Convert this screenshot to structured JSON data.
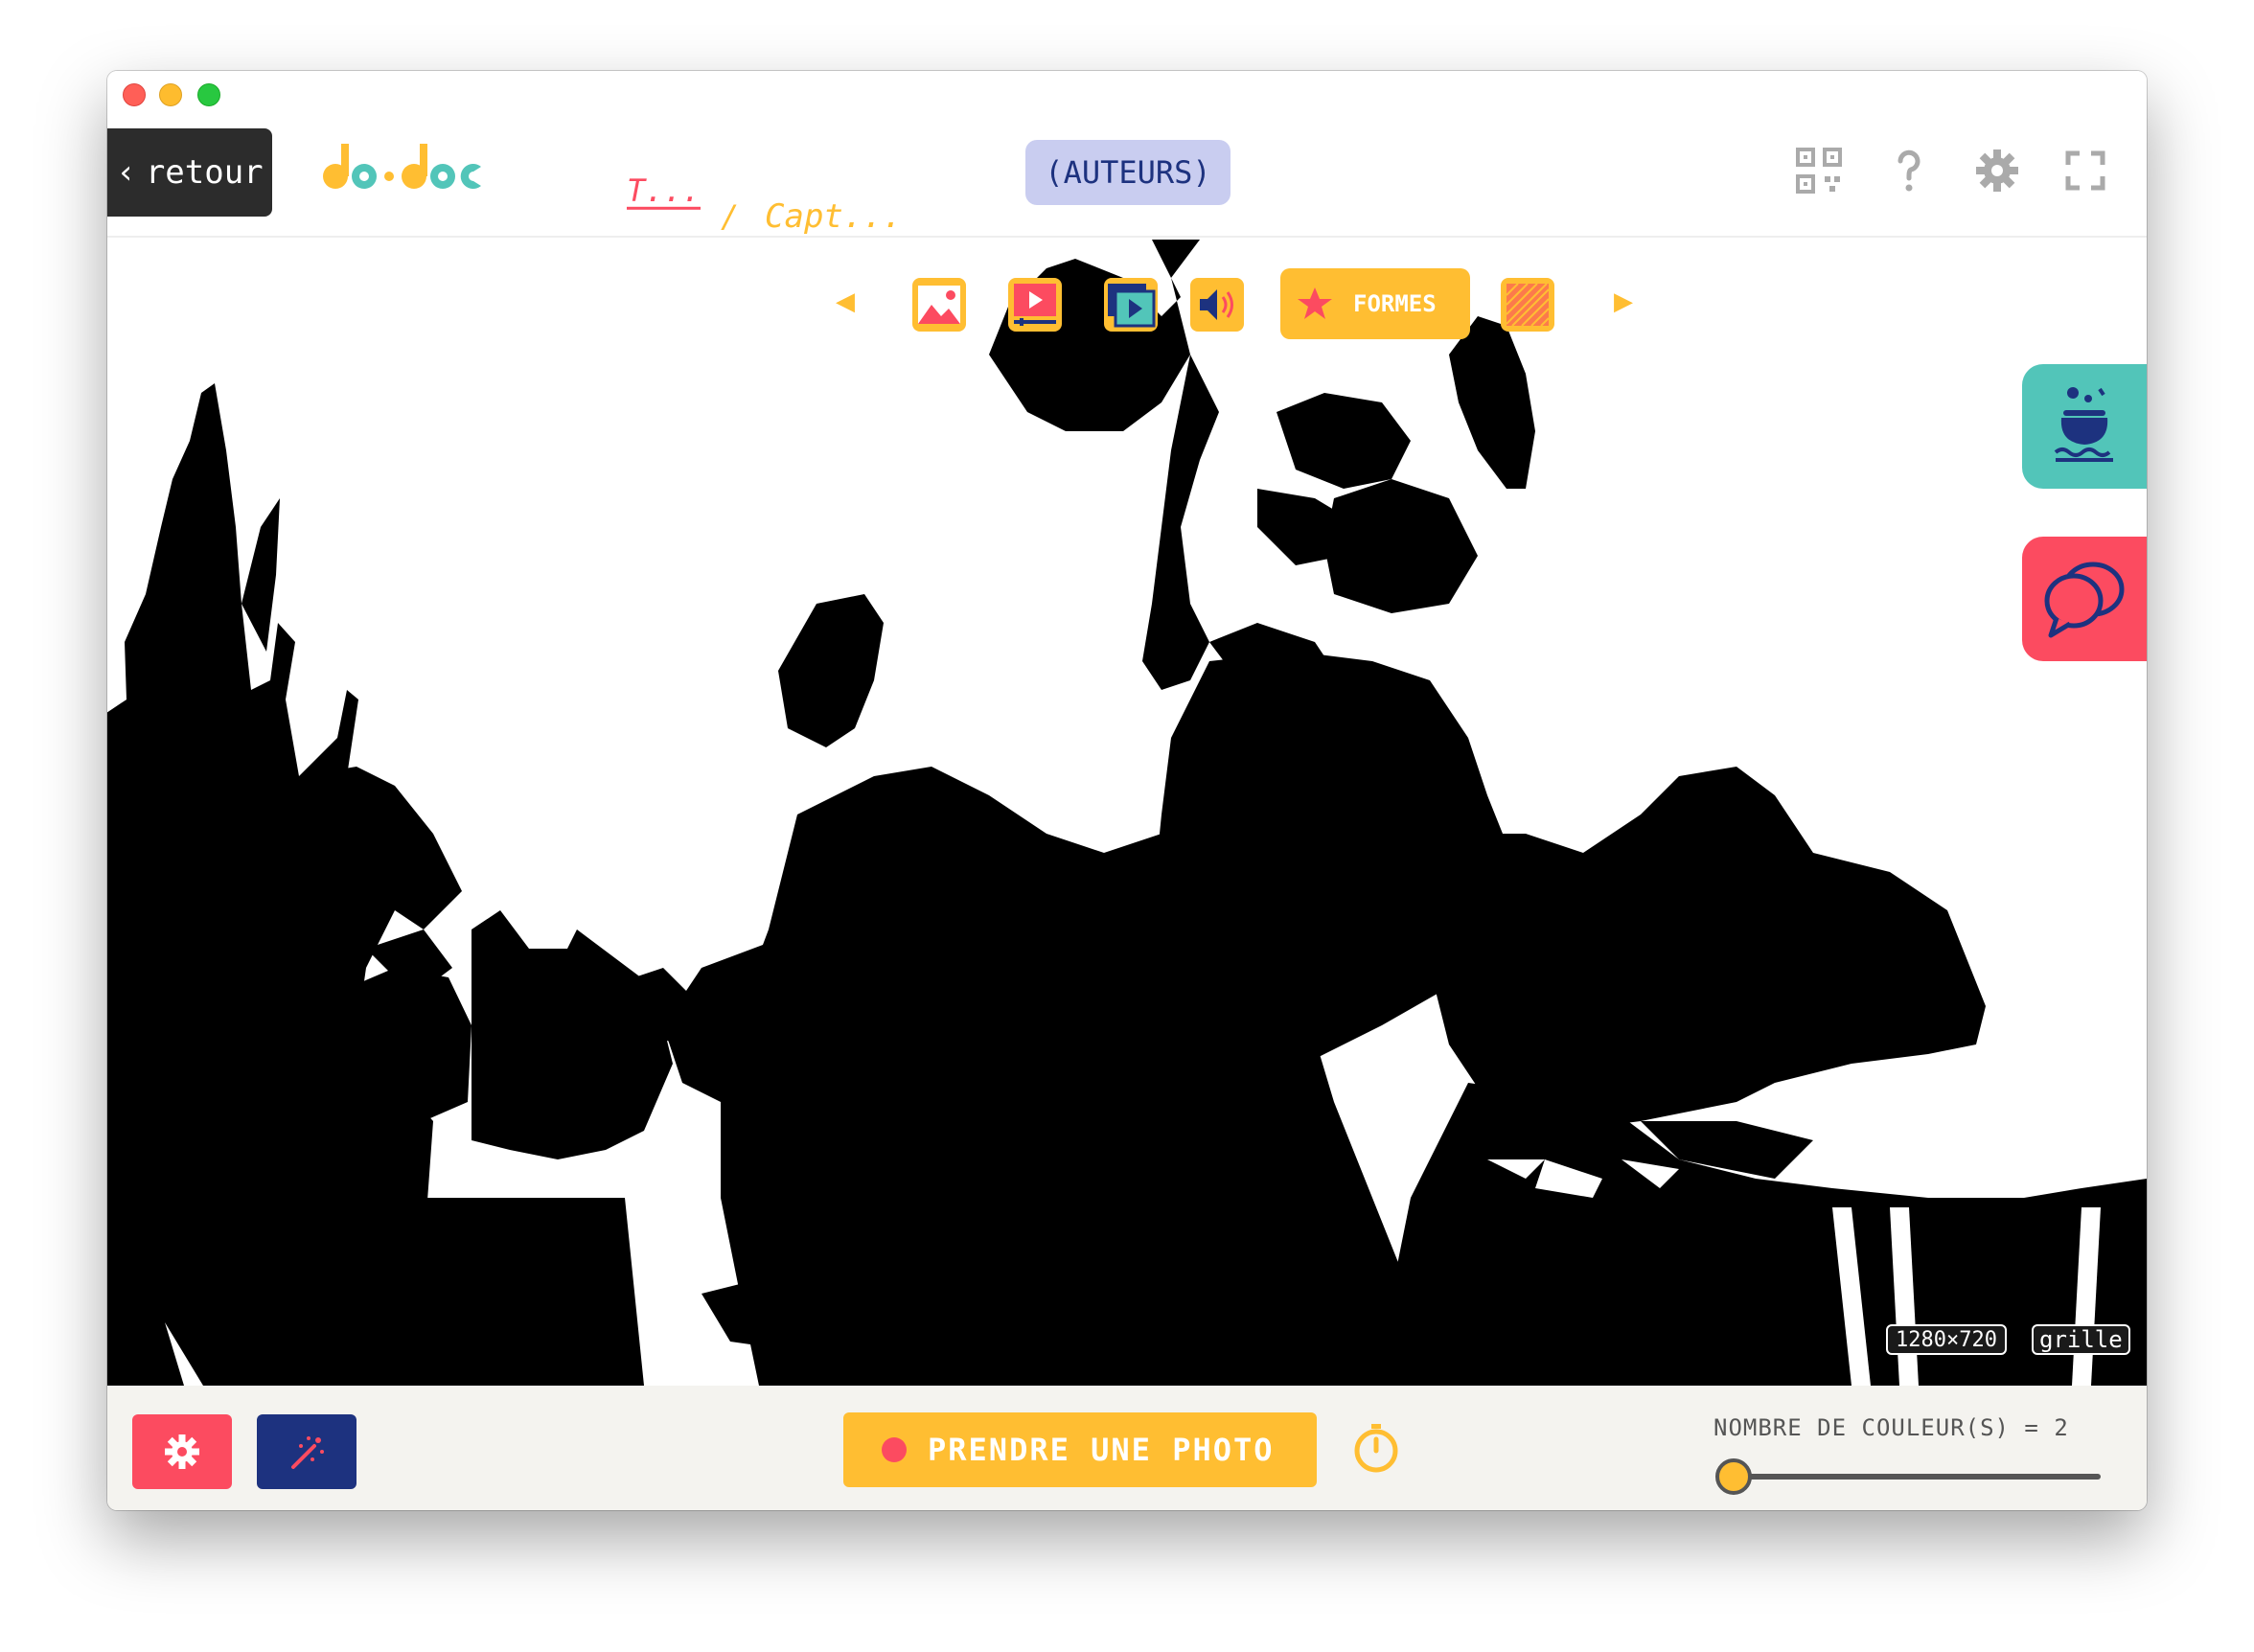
{
  "window": {
    "traffic_lights": [
      "close",
      "minimize",
      "maximize"
    ]
  },
  "topbar": {
    "back_label": "retour",
    "back_icon": "chevron-left-icon",
    "logo_text": "do•doc",
    "breadcrumb": [
      "T...",
      "Capt..."
    ],
    "breadcrumb_separator": "/",
    "authors_label": "(AUTEURS)",
    "icons": [
      "qr-code-icon",
      "help-icon",
      "gear-icon",
      "fullscreen-icon"
    ]
  },
  "capture_modes": {
    "prev_arrow": "◀",
    "next_arrow": "▶",
    "modes": [
      "photo",
      "video",
      "stop-motion",
      "audio",
      "formes",
      "vecteur"
    ],
    "active_label": "FORMES"
  },
  "side_panels": [
    "cauldron-icon",
    "chat-icon"
  ],
  "preview": {
    "resolution": "1280×720",
    "grid_label": "grille"
  },
  "bottombar": {
    "settings_icon": "gear-icon",
    "effects_icon": "magic-wand-icon",
    "take_photo_label": "PRENDRE UNE PHOTO",
    "timer_icon": "timer-icon",
    "colors_label": "NOMBRE DE COULEUR(S) = 2",
    "colors_slider_fraction": 0
  },
  "colors": {
    "accent_yellow": "#ffbe32",
    "accent_red": "#fc4b60",
    "accent_teal": "#52c5b9",
    "navy": "#1d327f",
    "dark": "#2c2c2c"
  }
}
